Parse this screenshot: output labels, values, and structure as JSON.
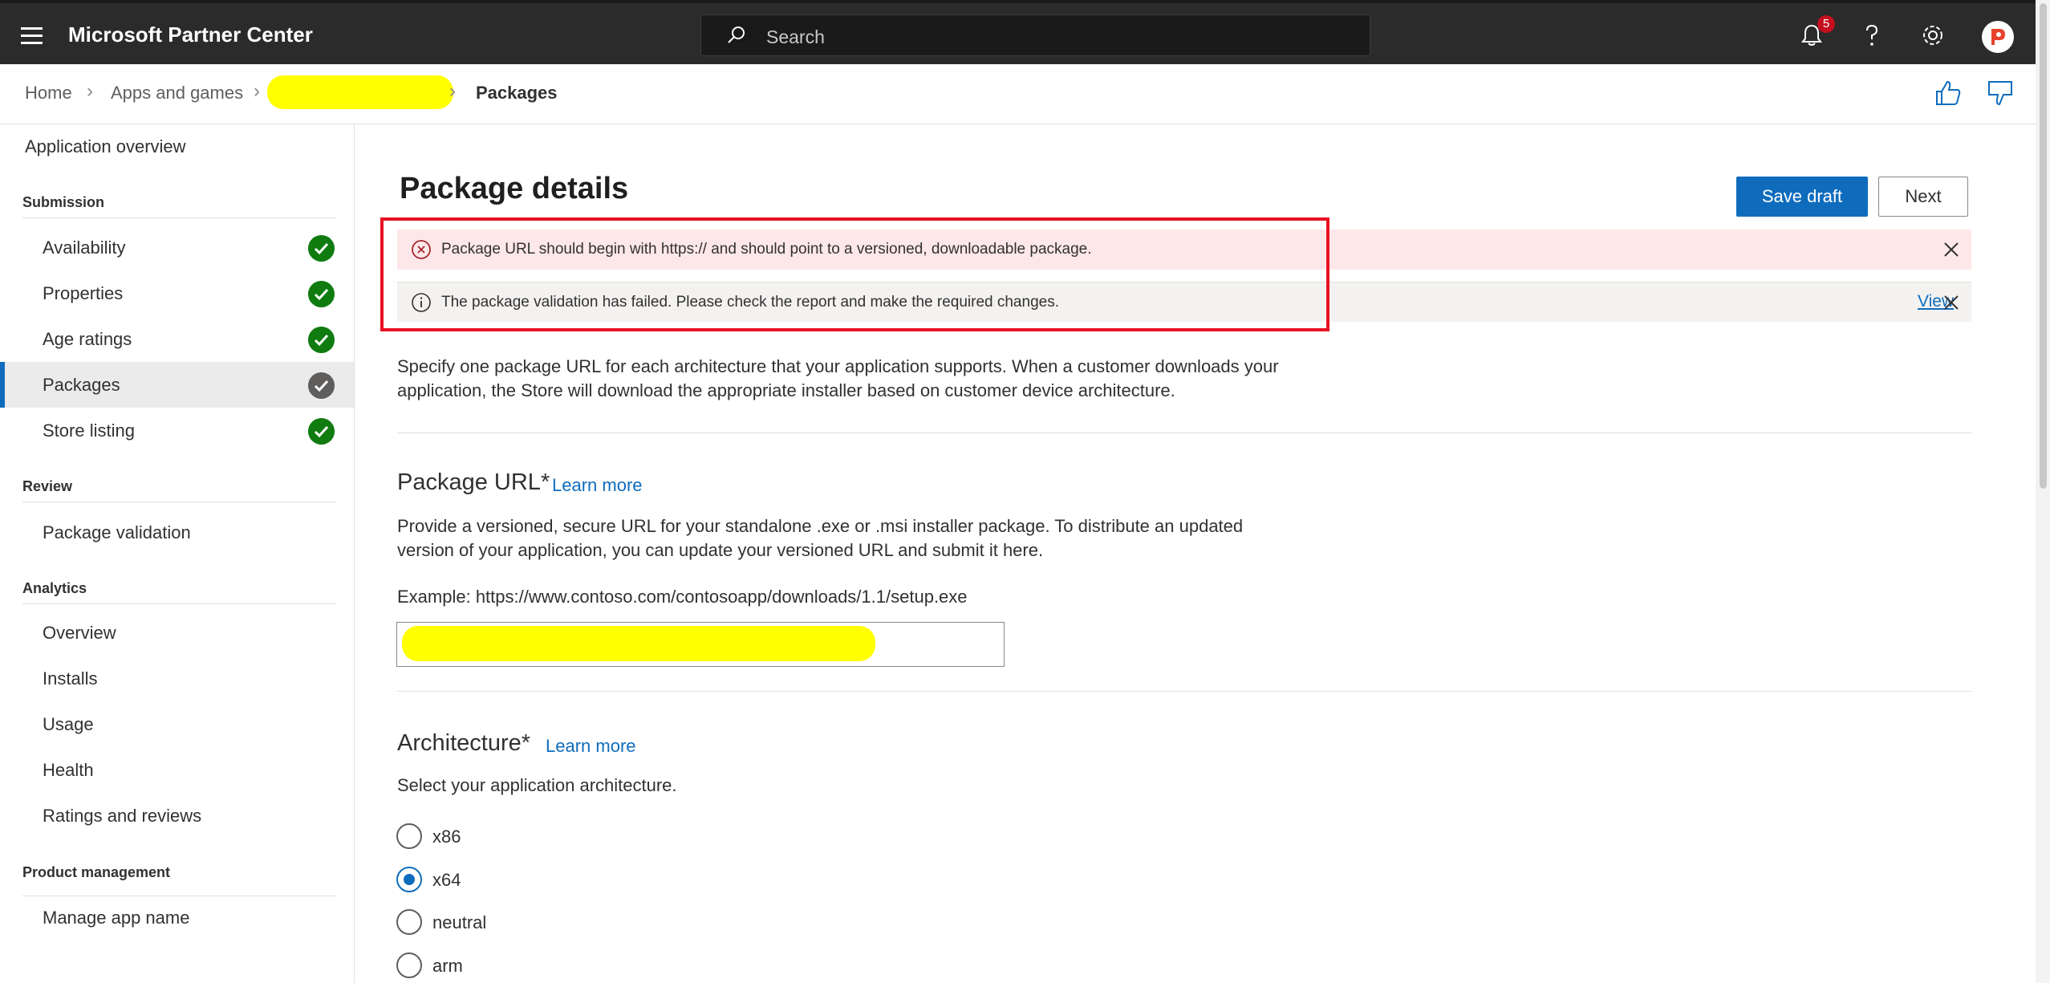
{
  "topbar": {
    "brand": "Microsoft Partner Center",
    "search_placeholder": "Search",
    "notification_count": "5"
  },
  "breadcrumb": {
    "home": "Home",
    "apps": "Apps and games",
    "current": "Packages"
  },
  "sidebar": {
    "overview": "Application overview",
    "submission_header": "Submission",
    "submission_items": [
      {
        "label": "Availability",
        "status": "complete"
      },
      {
        "label": "Properties",
        "status": "complete"
      },
      {
        "label": "Age ratings",
        "status": "complete"
      },
      {
        "label": "Packages",
        "status": "complete-current"
      },
      {
        "label": "Store listing",
        "status": "complete"
      }
    ],
    "review_header": "Review",
    "review_items": [
      "Package validation"
    ],
    "analytics_header": "Analytics",
    "analytics_items": [
      "Overview",
      "Installs",
      "Usage",
      "Health",
      "Ratings and reviews"
    ],
    "product_header": "Product management",
    "product_items": [
      "Manage app name"
    ]
  },
  "main": {
    "title": "Package details",
    "save_draft": "Save draft",
    "next": "Next",
    "error_message": "Package URL should begin with https:// and should point to a versioned, downloadable package.",
    "info_message": "The package validation has failed. Please check the report and make the required changes.",
    "info_link": "View",
    "intro_line1": "Specify one package URL for each architecture that your application supports. When a customer downloads your",
    "intro_line2": "application, the Store will download the appropriate installer based on customer device architecture.",
    "package_url_heading": "Package URL",
    "required_mark": "*",
    "learn_more": "Learn more",
    "package_url_desc1": "Provide a versioned, secure URL for your standalone .exe or .msi installer package. To distribute an updated",
    "package_url_desc2": "version of your application, you can update your versioned URL and submit it here.",
    "example": "Example: https://www.contoso.com/contosoapp/downloads/1.1/setup.exe",
    "architecture_heading": "Architecture",
    "architecture_desc": "Select your application architecture.",
    "architectures": [
      {
        "label": "x86",
        "checked": false
      },
      {
        "label": "x64",
        "checked": true
      },
      {
        "label": "neutral",
        "checked": false
      },
      {
        "label": "arm",
        "checked": false
      }
    ]
  },
  "colors": {
    "accent": "#0f6cbd",
    "success": "#107c10",
    "error_bg": "#fde7e9",
    "annotation_red": "#e81123",
    "redaction_yellow": "#ffff00"
  }
}
